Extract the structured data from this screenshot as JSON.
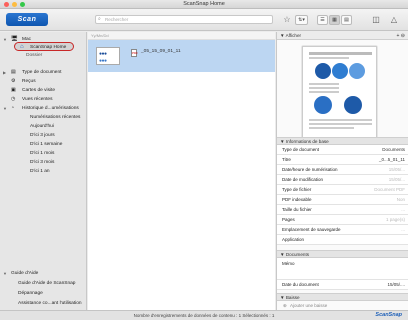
{
  "window": {
    "title": "ScanSnap Home"
  },
  "toolbar": {
    "scan_label": "Scan",
    "search_placeholder": "Rechercher",
    "sort_icon": "sort-icon",
    "icons": [
      "star-icon",
      "sort-icon",
      "list-view-icon",
      "thumbnail-view-icon",
      "large-thumbnail-view-icon",
      "panel-icon",
      "notification-icon"
    ]
  },
  "sidebar": {
    "mac_label": "Mac",
    "scansnap_home_label": "ScanSnap Home",
    "hidden_label": "Dossier",
    "type_label": "Type de document",
    "recu_label": "Reçus",
    "bizcard_label": "Cartes de visite",
    "recent_label": "Vues récentes",
    "history_label": "Historique d...umérisations",
    "history_items": [
      "Numérisations récentes",
      "Aujourd'hui",
      "D'ici 3 jours",
      "D'ici 1 semaine",
      "D'ici 1 mois",
      "D'ici 3 mois",
      "D'ici 1 an"
    ],
    "help_label": "Guide d'Aide",
    "help_items": [
      "Guide d'Aide de ScanSnap",
      "Dépannage",
      "Assistance co...ant l'utilisation"
    ]
  },
  "content": {
    "path": "Yy/Mn/Dd",
    "file_name": "_05_15_09_01_11"
  },
  "right_panel": {
    "preview_label": "Afficher",
    "info_section": "Informations de base",
    "props": [
      {
        "key": "Type de document",
        "value": "Documents"
      },
      {
        "key": "Titre",
        "value": "_0...5_01_11"
      },
      {
        "key": "Date/heure de numérisation",
        "value": "15/05/..."
      },
      {
        "key": "Date de modification",
        "value": "15/05/..."
      },
      {
        "key": "Type de fichier",
        "value": "Document PDF"
      },
      {
        "key": "PDF indexable",
        "value": "Non"
      },
      {
        "key": "Taille du fichier",
        "value": "..."
      },
      {
        "key": "Pages",
        "value": "1 page(s)"
      },
      {
        "key": "Emplacement de sauvegarde",
        "value": "..."
      },
      {
        "key": "Application",
        "value": ""
      }
    ],
    "documents_section": "Documents",
    "memo_label": "Mémo",
    "doc_date_label": "Date du document",
    "doc_date_value": "15/05/....",
    "baisse_section": "Baisse",
    "add_label": "Ajouter une baisse"
  },
  "status": {
    "text": "Nombre d'enregistrements de données de contenu : 1 Sélectionnés : 1",
    "brand": "ScanSnap"
  },
  "colors": {
    "accent": "#1e63be",
    "selection": "#bcd6f2",
    "highlight_border": "#c82828"
  }
}
